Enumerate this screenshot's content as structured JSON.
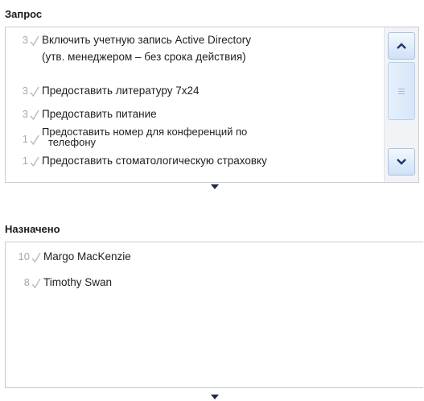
{
  "request": {
    "title": "Запрос",
    "items": [
      {
        "count": "3",
        "line1": "Включить учетную запись Active Directory",
        "line2": "(утв. менеджером – без срока действия)"
      },
      {
        "count": "3",
        "line1": "Предоставить литературу 7x24"
      },
      {
        "count": "3",
        "line1": "Предоставить питание"
      },
      {
        "count": "1",
        "line1": "Предоставить номер для конференций по",
        "line2": "телефону"
      },
      {
        "count": "1",
        "line1": "Предоставить стоматологическую страховку"
      }
    ]
  },
  "assigned": {
    "title": "Назначено",
    "items": [
      {
        "count": "10",
        "name": "Margo MacKenzie"
      },
      {
        "count": "8",
        "name": "Timothy Swan"
      }
    ]
  },
  "icons": {
    "check": "check-icon",
    "scroll_up": "chevron-up-icon",
    "scroll_down": "chevron-down-icon",
    "splitter": "triangle-down-icon"
  },
  "colors": {
    "check": "#b9c7b0",
    "count": "#a8a8a8",
    "scroll_arrow": "#1f3a66",
    "splitter": "#1c2a4a"
  }
}
